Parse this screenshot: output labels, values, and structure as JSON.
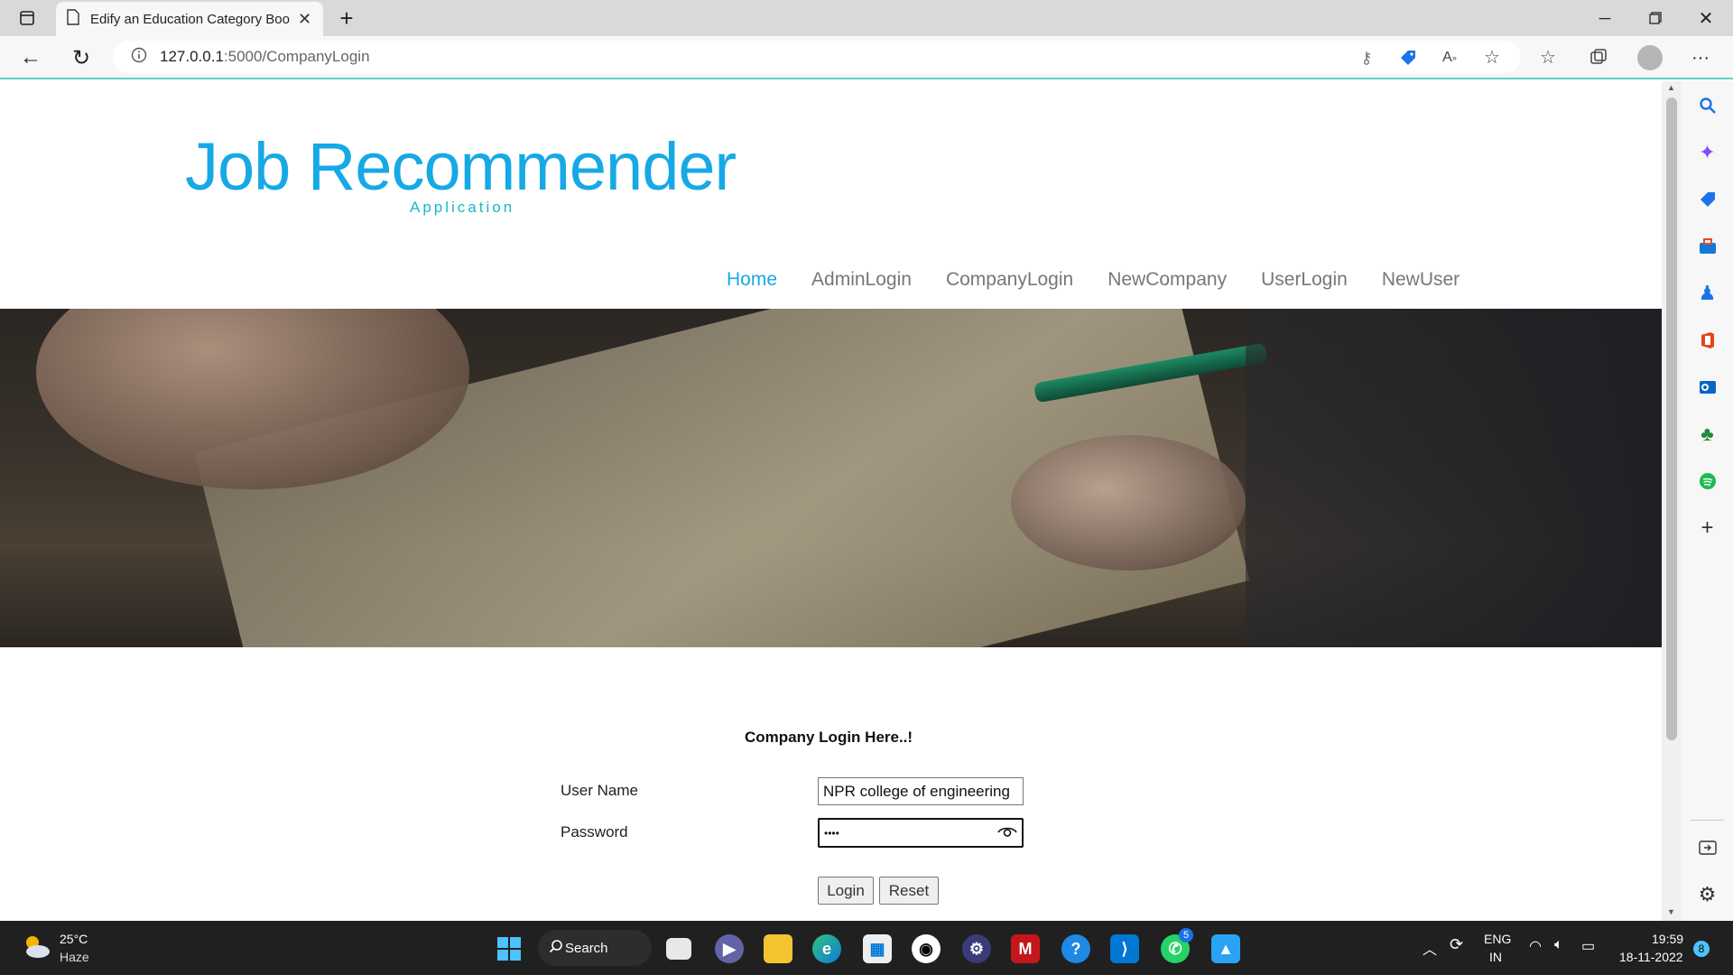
{
  "browser": {
    "tab_title": "Edify an Education Category Boo",
    "url_host": "127.0.0.1",
    "url_path": ":5000/CompanyLogin"
  },
  "site": {
    "title": "Job Recommender",
    "subtitle": "Application",
    "nav": [
      {
        "label": "Home",
        "active": true
      },
      {
        "label": "AdminLogin"
      },
      {
        "label": "CompanyLogin"
      },
      {
        "label": "NewCompany"
      },
      {
        "label": "UserLogin"
      },
      {
        "label": "NewUser"
      }
    ]
  },
  "form": {
    "heading": "Company Login Here..!",
    "username_label": "User Name",
    "username_value": "NPR college of engineering",
    "password_label": "Password",
    "password_value": "••••",
    "login_button": "Login",
    "reset_button": "Reset"
  },
  "taskbar": {
    "weather_temp": "25°C",
    "weather_desc": "Haze",
    "search_label": "Search",
    "lang_top": "ENG",
    "lang_bottom": "IN",
    "time": "19:59",
    "date": "18-11-2022",
    "notification_count": "8",
    "whatsapp_badge": "5"
  },
  "colors": {
    "brand": "#16a9e6",
    "subtitle": "#18b7c8",
    "address_underline": "#5fd0c8"
  }
}
